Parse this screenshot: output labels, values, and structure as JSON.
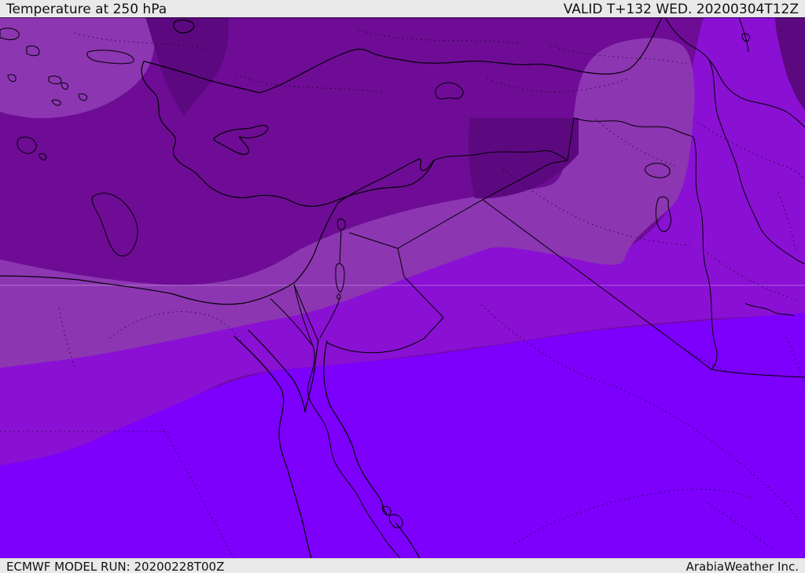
{
  "header": {
    "title": "Temperature at 250 hPa",
    "valid_time": "VALID T+132 WED. 20200304T12Z"
  },
  "footer": {
    "model_run": "ECMWF MODEL RUN: 20200228T00Z",
    "attribution": "ArabiaWeather Inc."
  },
  "map": {
    "type": "weather-contour-map",
    "parameter": "Temperature",
    "pressure_level": "250 hPa",
    "model": "ECMWF",
    "colors": {
      "band_coldest": "#5C0980",
      "band_cold": "#6E0C96",
      "band_mild": "#8C36B2",
      "band_warm": "#8A10D4",
      "band_warmest": "#7C00FB",
      "coastline": "#000000",
      "bar_background": "#e9e9e9",
      "bar_text": "#111111"
    }
  }
}
